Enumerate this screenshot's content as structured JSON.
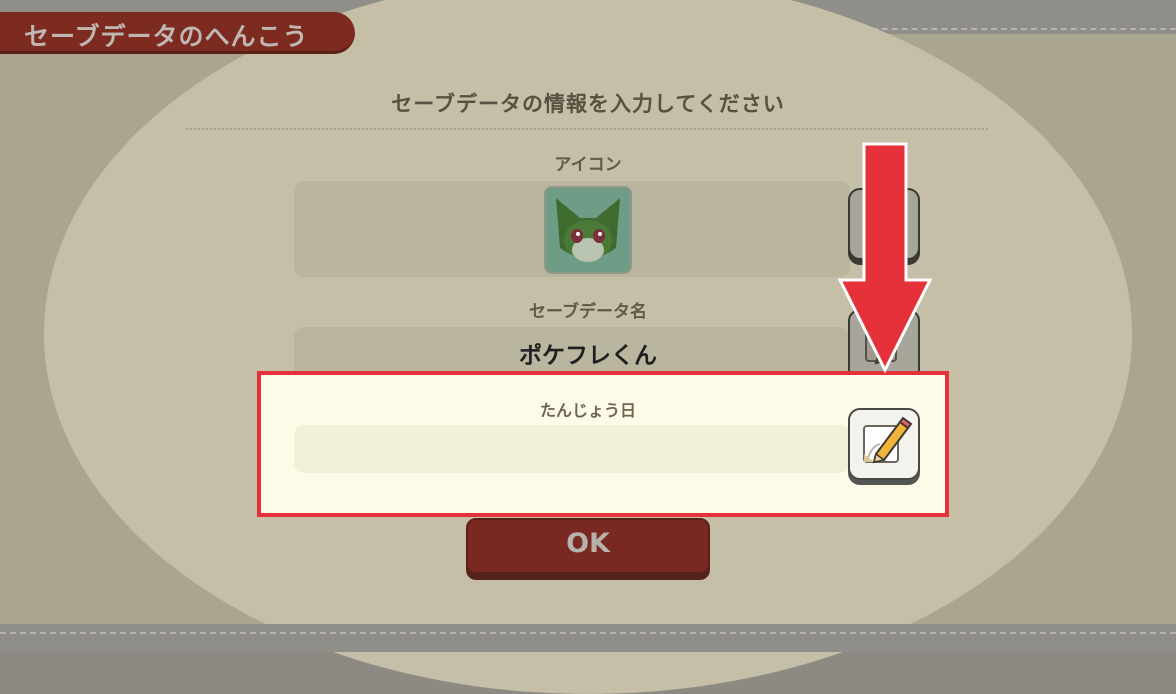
{
  "screen": {
    "title": "セーブデータのへんこう",
    "heading": "セーブデータの情報を入力してください"
  },
  "fields": {
    "icon_label": "アイコン",
    "save_name_label": "セーブデータ名",
    "save_name_value": "ポケフレくん",
    "birthday_label": "たんじょう日",
    "birthday_value": ""
  },
  "ok_label": "OK",
  "colors": {
    "highlight_border": "#e5323a",
    "arrow": "#e5323a",
    "title_tab": "#7d2a21",
    "ok_button": "#7a2922"
  },
  "icons": {
    "avatar": "sprigatito-icon",
    "edit": "pencil-notepad-icon"
  }
}
